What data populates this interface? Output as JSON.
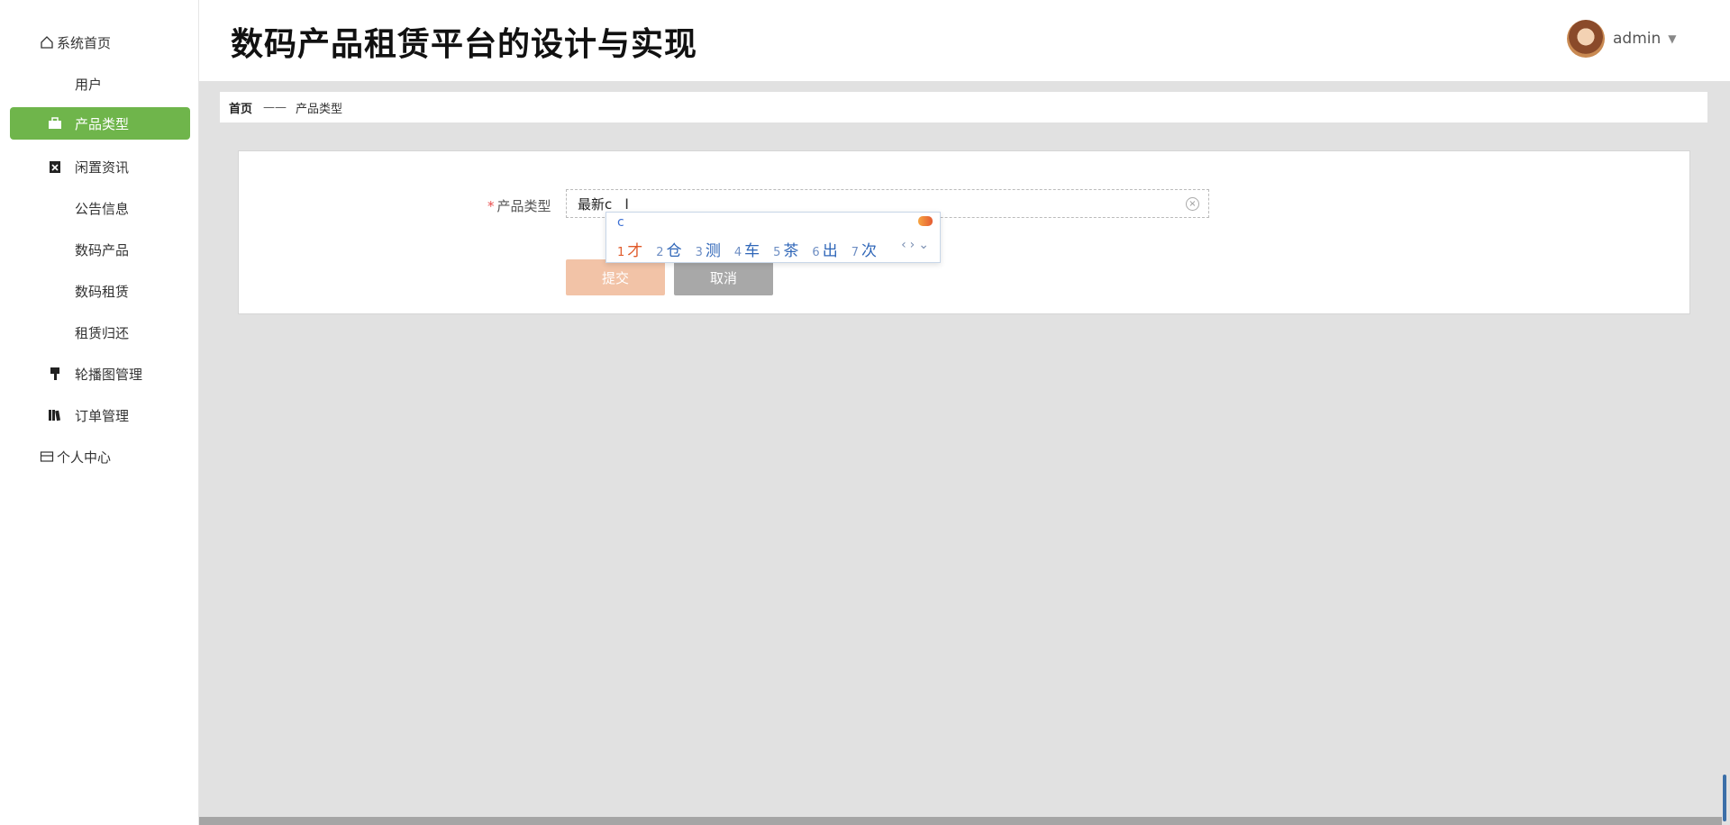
{
  "sidebar": {
    "items": [
      {
        "label": "系统首页",
        "icon": "home-icon"
      },
      {
        "label": "用户",
        "icon": "grid-icon"
      },
      {
        "label": "产品类型",
        "icon": "briefcase-icon"
      },
      {
        "label": "闲置资讯",
        "icon": "clipboard-x-icon"
      },
      {
        "label": "公告信息",
        "icon": "grid9-icon"
      },
      {
        "label": "数码产品",
        "icon": "grid-icon"
      },
      {
        "label": "数码租赁",
        "icon": "grid-icon"
      },
      {
        "label": "租赁归还",
        "icon": "grid-icon"
      },
      {
        "label": "轮播图管理",
        "icon": "brush-icon"
      },
      {
        "label": "订单管理",
        "icon": "books-icon"
      },
      {
        "label": "个人中心",
        "icon": "card-icon"
      }
    ],
    "active_label": "产品类型",
    "active_color": "#6fb54b"
  },
  "header": {
    "title": "数码产品租赁平台的设计与实现",
    "username": "admin"
  },
  "breadcrumb": {
    "home": "首页",
    "separator": "——",
    "current": "产品类型"
  },
  "form": {
    "field_label": "产品类型",
    "required_mark": "*",
    "input_value": "最新c",
    "submit_label": "提交",
    "cancel_label": "取消"
  },
  "ime": {
    "composition": "c",
    "candidates": [
      {
        "num": "1",
        "text": "才"
      },
      {
        "num": "2",
        "text": "仓"
      },
      {
        "num": "3",
        "text": "测"
      },
      {
        "num": "4",
        "text": "车"
      },
      {
        "num": "5",
        "text": "茶"
      },
      {
        "num": "6",
        "text": "出"
      },
      {
        "num": "7",
        "text": "次"
      }
    ]
  }
}
